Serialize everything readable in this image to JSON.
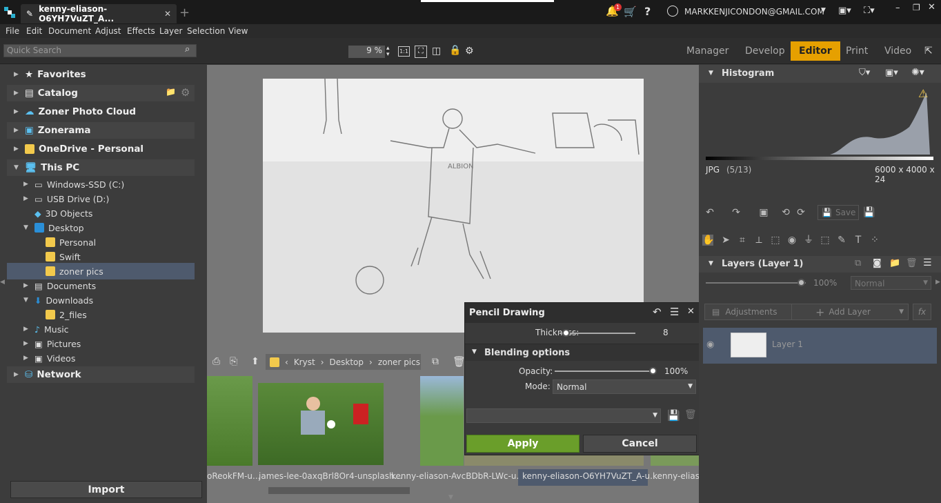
{
  "window": {
    "tab_title": "kenny-eliason-O6YH7VuZT_A...",
    "notification_count": "1",
    "account": "MARKKENJICONDON@GMAIL.COM"
  },
  "menu": [
    "File",
    "Edit",
    "Document",
    "Adjust",
    "Effects",
    "Layer",
    "Selection",
    "View"
  ],
  "toolbar": {
    "search_placeholder": "Quick Search",
    "zoom": "9 %",
    "one_to_one": "1:1"
  },
  "modes": {
    "manager": "Manager",
    "develop": "Develop",
    "editor": "Editor",
    "print": "Print",
    "video": "Video"
  },
  "navigator": {
    "favorites": "Favorites",
    "catalog": "Catalog",
    "cloud": "Zoner Photo Cloud",
    "zonerama": "Zonerama",
    "onedrive": "OneDrive - Personal",
    "thispc": "This PC",
    "windows_ssd": "Windows-SSD (C:)",
    "usb": "USB Drive (D:)",
    "objects3d": "3D Objects",
    "desktop": "Desktop",
    "personal": "Personal",
    "swift": "Swift",
    "zonerpics": "zoner pics",
    "documents": "Documents",
    "downloads": "Downloads",
    "files2": "2_files",
    "music": "Music",
    "pictures": "Pictures",
    "videos": "Videos",
    "network": "Network",
    "import": "Import"
  },
  "breadcrumb": {
    "a": "Kryst",
    "b": "Desktop",
    "c": "zoner pics"
  },
  "filmstrip": [
    "oReokFM-u...",
    "james-lee-0axqBrl8Or4-unsplash...",
    "kenny-eliason-AvcBDbR-LWc-u...",
    "kenny-eliason-O6YH7VuZT_A-u...",
    "kenny-eliaso"
  ],
  "dialog": {
    "title": "Pencil Drawing",
    "thickness_label": "Thickness:",
    "thickness_value": "8",
    "thickness": 0.08,
    "blending": "Blending options",
    "opacity_label": "Opacity:",
    "opacity_value": "100%",
    "mode_label": "Mode:",
    "mode_value": "Normal",
    "apply": "Apply",
    "cancel": "Cancel"
  },
  "histogram": {
    "title": "Histogram",
    "format": "JPG",
    "index": "(5/13)",
    "dimensions": "6000 x 4000 x 24"
  },
  "edit": {
    "save": "Save"
  },
  "layers": {
    "title": "Layers (Layer 1)",
    "opacity": "100%",
    "mode": "Normal",
    "adjustments": "Adjustments",
    "add_layer": "Add Layer",
    "layer1": "Layer 1"
  },
  "colors": {
    "accent": "#e6a000",
    "apply": "#6a9e2a",
    "selection": "#4e5a6d"
  }
}
